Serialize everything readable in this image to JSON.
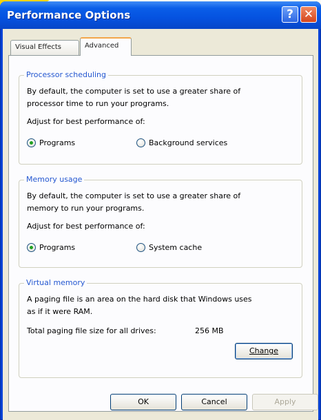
{
  "window": {
    "title": "Performance Options"
  },
  "titlebar_buttons": {
    "help": "?",
    "close": "✕"
  },
  "tabs": [
    {
      "label": "Visual Effects",
      "selected": false
    },
    {
      "label": "Advanced",
      "selected": true
    }
  ],
  "processor_scheduling": {
    "title": "Processor scheduling",
    "description_line1": "By default, the computer is set to use a greater share of",
    "description_line2": "processor time to run your programs.",
    "adjust_label": "Adjust for best performance of:",
    "options": [
      {
        "label": "Programs",
        "selected": true
      },
      {
        "label": "Background services",
        "selected": false
      }
    ]
  },
  "memory_usage": {
    "title": "Memory usage",
    "description_line1": "By default, the computer is set to use a greater share of",
    "description_line2": "memory to run your programs.",
    "adjust_label": "Adjust for best performance of:",
    "options": [
      {
        "label": "Programs",
        "selected": true
      },
      {
        "label": "System cache",
        "selected": false
      }
    ]
  },
  "virtual_memory": {
    "title": "Virtual memory",
    "description_line1": "A paging file is an area on the hard disk that Windows uses",
    "description_line2": "as if it were RAM.",
    "paging_size_label": "Total paging file size for all drives:",
    "paging_size_value": "256 MB",
    "change_button": "Change"
  },
  "footer": {
    "ok_label": "OK",
    "cancel_label": "Cancel",
    "apply_label": "Apply"
  },
  "colors": {
    "titlebar": "#0552e0",
    "group_title": "#2457d0",
    "radio_dot": "#21a121"
  }
}
